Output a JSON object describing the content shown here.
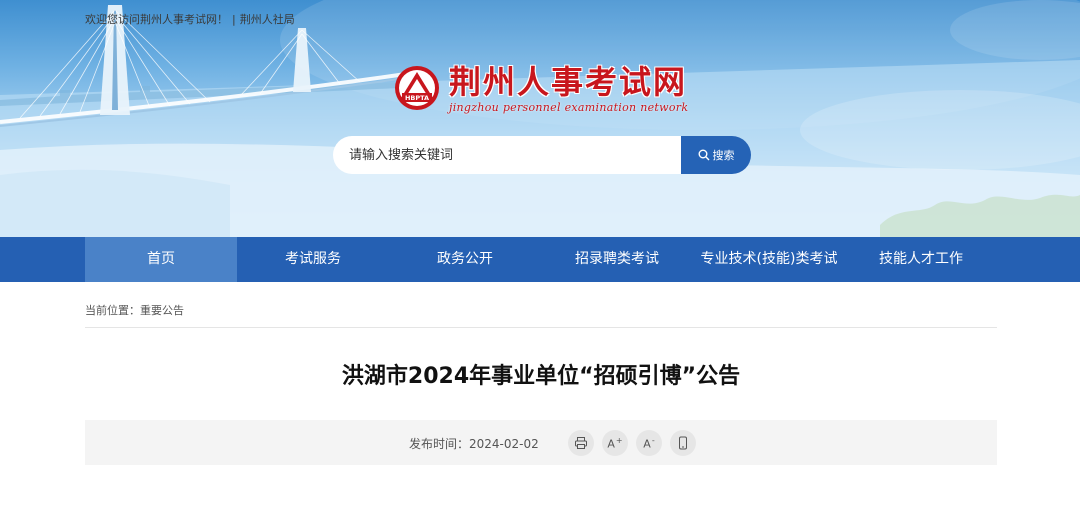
{
  "topbar": {
    "welcome": "欢迎您访问荆州人事考试网！",
    "separator": "|",
    "link": "荆州人社局"
  },
  "logo": {
    "emblem_text": "HBPTA",
    "name_cn": "荆州人事考试网",
    "name_en": "jingzhou personnel examination network"
  },
  "search": {
    "placeholder": "请输入搜索关键词",
    "button_label": "搜索",
    "icon": "search-icon"
  },
  "nav": {
    "items": [
      {
        "label": "首页",
        "active": true
      },
      {
        "label": "考试服务",
        "active": false
      },
      {
        "label": "政务公开",
        "active": false
      },
      {
        "label": "招录聘类考试",
        "active": false
      },
      {
        "label": "专业技术(技能)类考试",
        "active": false
      },
      {
        "label": "技能人才工作",
        "active": false
      }
    ]
  },
  "breadcrumb": {
    "prefix": "当前位置：",
    "current": "重要公告"
  },
  "article": {
    "title": "洪湖市2024年事业单位“招硕引博”公告",
    "date_label": "发布时间：",
    "date": "2024-02-02",
    "tools": [
      "print-icon",
      "font-increase-icon",
      "font-decrease-icon",
      "mobile-icon"
    ],
    "font_tool_letter": "A",
    "increase_mark": "+",
    "decrease_mark": "-"
  },
  "colors": {
    "nav_bg": "#2560b3",
    "nav_active": "#4a82c8",
    "brand_red": "#c8161d",
    "search_button": "#2563b6"
  }
}
